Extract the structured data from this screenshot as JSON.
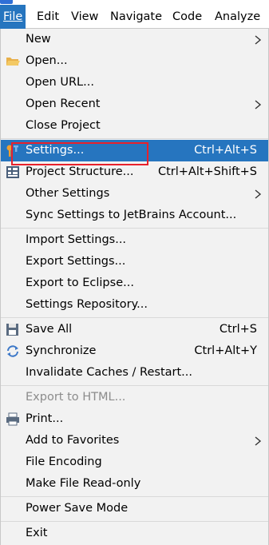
{
  "menubar": {
    "items": [
      {
        "label": "File",
        "underline": "F",
        "active": true
      },
      {
        "label": "Edit",
        "underline": "E",
        "active": false
      },
      {
        "label": "View",
        "underline": "V",
        "active": false
      },
      {
        "label": "Navigate",
        "underline": "N",
        "active": false
      },
      {
        "label": "Code",
        "underline": "C",
        "active": false
      },
      {
        "label": "Analyze",
        "underline": "",
        "active": false
      }
    ]
  },
  "file_menu": {
    "items": [
      {
        "label": "New",
        "shortcut": "",
        "submenu": true
      },
      {
        "label": "Open...",
        "shortcut": "",
        "submenu": false,
        "icon": "folder-icon"
      },
      {
        "label": "Open URL...",
        "shortcut": "",
        "submenu": false
      },
      {
        "label": "Open Recent",
        "shortcut": "",
        "submenu": true
      },
      {
        "label": "Close Project",
        "shortcut": "",
        "submenu": false
      },
      {
        "label": "Settings...",
        "shortcut": "Ctrl+Alt+S",
        "submenu": false,
        "icon": "settings-wrench-icon",
        "selected": true
      },
      {
        "label": "Project Structure...",
        "shortcut": "Ctrl+Alt+Shift+S",
        "submenu": false,
        "icon": "project-structure-icon"
      },
      {
        "label": "Other Settings",
        "shortcut": "",
        "submenu": true
      },
      {
        "label": "Sync Settings to JetBrains Account...",
        "shortcut": "",
        "submenu": false
      },
      {
        "label": "Import Settings...",
        "shortcut": "",
        "submenu": false
      },
      {
        "label": "Export Settings...",
        "shortcut": "",
        "submenu": false
      },
      {
        "label": "Export to Eclipse...",
        "shortcut": "",
        "submenu": false
      },
      {
        "label": "Settings Repository...",
        "shortcut": "",
        "submenu": false
      },
      {
        "label": "Save All",
        "shortcut": "Ctrl+S",
        "submenu": false,
        "icon": "save-icon"
      },
      {
        "label": "Synchronize",
        "shortcut": "Ctrl+Alt+Y",
        "submenu": false,
        "icon": "synchronize-icon"
      },
      {
        "label": "Invalidate Caches / Restart...",
        "shortcut": "",
        "submenu": false
      },
      {
        "label": "Export to HTML...",
        "shortcut": "",
        "submenu": false,
        "disabled": true
      },
      {
        "label": "Print...",
        "shortcut": "",
        "submenu": false,
        "icon": "printer-icon"
      },
      {
        "label": "Add to Favorites",
        "shortcut": "",
        "submenu": true
      },
      {
        "label": "File Encoding",
        "shortcut": "",
        "submenu": false
      },
      {
        "label": "Make File Read-only",
        "shortcut": "",
        "submenu": false
      },
      {
        "label": "Power Save Mode",
        "shortcut": "",
        "submenu": false
      },
      {
        "label": "Exit",
        "shortcut": "",
        "submenu": false
      }
    ]
  },
  "colors": {
    "selection": "#2675bf",
    "annotation_box": "#e8212b",
    "menu_background": "#f2f2f2",
    "disabled_text": "#8c8c8c"
  }
}
